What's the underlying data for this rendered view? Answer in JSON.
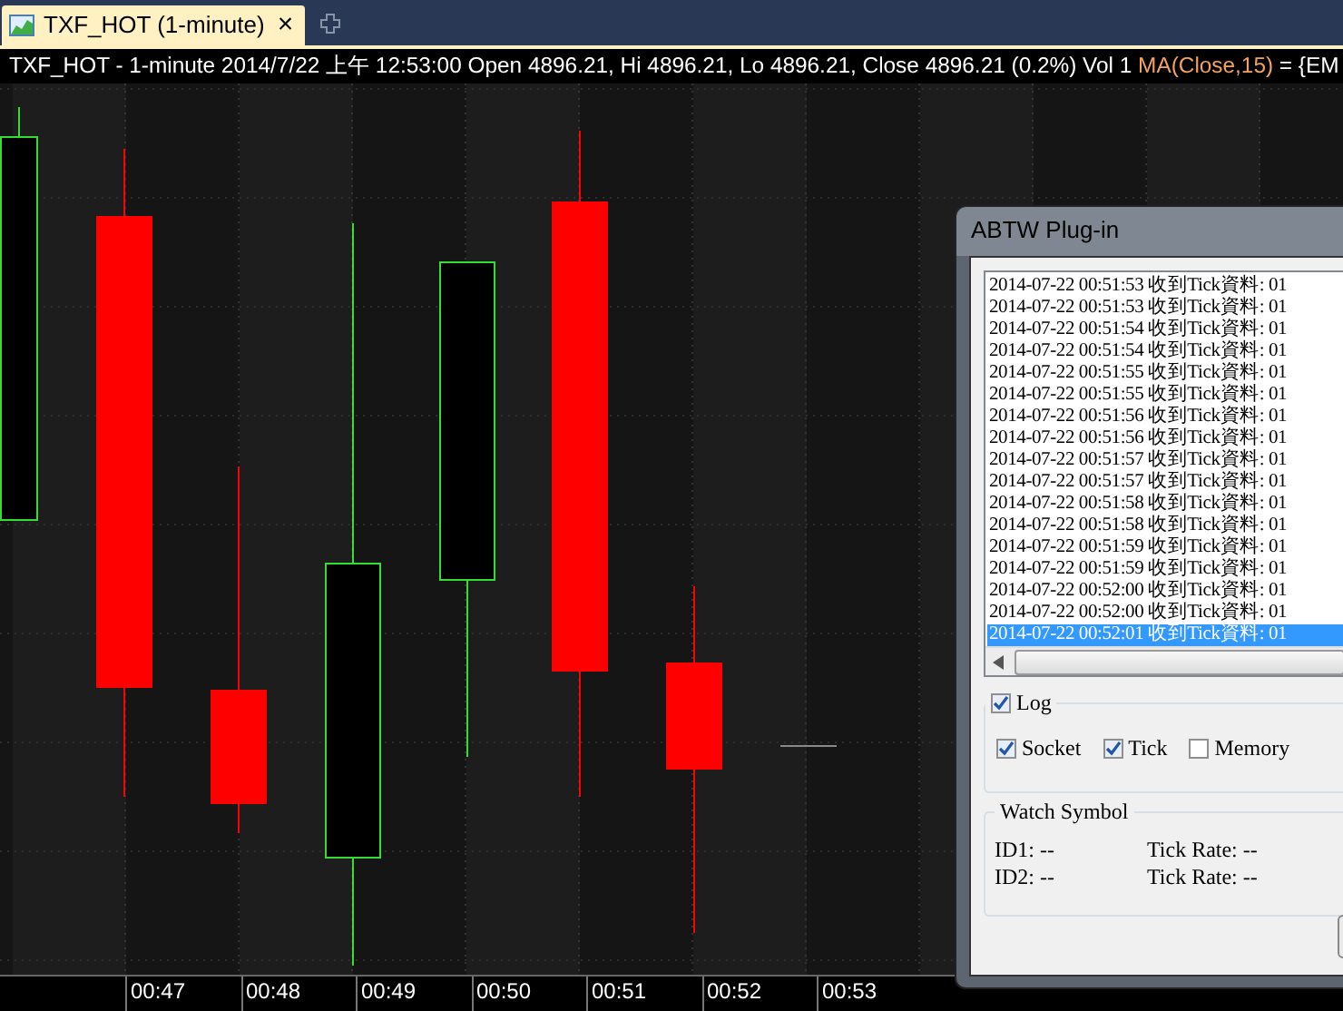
{
  "tabs": [
    {
      "label": "TXF_HOT (1-minute)",
      "close": "×",
      "selected": true
    }
  ],
  "info_line": {
    "text": "TXF_HOT - 1-minute 2014/7/22 上午 12:53:00 Open 4896.21, Hi 4896.21, Lo 4896.21, Close 4896.21 (0.2%) Vol 1",
    "indicator": "MA(Close,15)",
    "indicator_value": "= {EM"
  },
  "time_axis": [
    "00:47",
    "00:48",
    "00:49",
    "00:50",
    "00:51",
    "00:52",
    "00:53"
  ],
  "dialog": {
    "title": "ABTW Plug-in",
    "log": [
      {
        "text": "2014-07-22 00:51:53 收到Tick資料: 01",
        "selected": false
      },
      {
        "text": "2014-07-22 00:51:53 收到Tick資料: 01",
        "selected": false
      },
      {
        "text": "2014-07-22 00:51:54 收到Tick資料: 01",
        "selected": false
      },
      {
        "text": "2014-07-22 00:51:54 收到Tick資料: 01",
        "selected": false
      },
      {
        "text": "2014-07-22 00:51:55 收到Tick資料: 01",
        "selected": false
      },
      {
        "text": "2014-07-22 00:51:55 收到Tick資料: 01",
        "selected": false
      },
      {
        "text": "2014-07-22 00:51:56 收到Tick資料: 01",
        "selected": false
      },
      {
        "text": "2014-07-22 00:51:56 收到Tick資料: 01",
        "selected": false
      },
      {
        "text": "2014-07-22 00:51:57 收到Tick資料: 01",
        "selected": false
      },
      {
        "text": "2014-07-22 00:51:57 收到Tick資料: 01",
        "selected": false
      },
      {
        "text": "2014-07-22 00:51:58 收到Tick資料: 01",
        "selected": false
      },
      {
        "text": "2014-07-22 00:51:58 收到Tick資料: 01",
        "selected": false
      },
      {
        "text": "2014-07-22 00:51:59 收到Tick資料: 01",
        "selected": false
      },
      {
        "text": "2014-07-22 00:51:59 收到Tick資料: 01",
        "selected": false
      },
      {
        "text": "2014-07-22 00:52:00 收到Tick資料: 01",
        "selected": false
      },
      {
        "text": "2014-07-22 00:52:00 收到Tick資料: 01",
        "selected": false
      },
      {
        "text": "2014-07-22 00:52:01 收到Tick資料: 01",
        "selected": true
      }
    ],
    "log_group": {
      "label": "Log",
      "checked": true,
      "options": [
        {
          "label": "Socket",
          "checked": true
        },
        {
          "label": "Tick",
          "checked": true
        },
        {
          "label": "Memory",
          "checked": false
        }
      ]
    },
    "watch_group": {
      "title": "Watch Symbol",
      "rows": [
        {
          "id": "ID1: --",
          "rate": "Tick Rate: --"
        },
        {
          "id": "ID2: --",
          "rate": "Tick Rate: --"
        }
      ]
    }
  }
}
